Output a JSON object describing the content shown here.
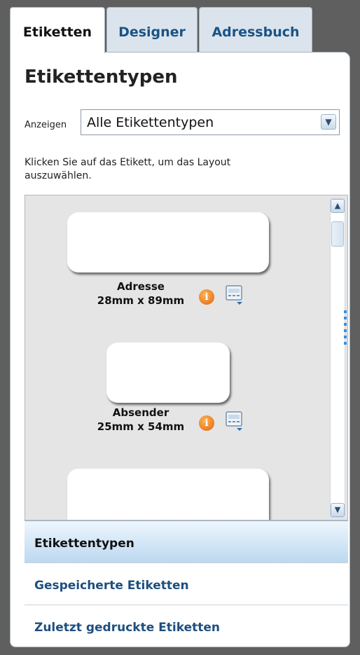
{
  "tabs": [
    {
      "label": "Etiketten",
      "active": true
    },
    {
      "label": "Designer",
      "active": false
    },
    {
      "label": "Adressbuch",
      "active": false
    }
  ],
  "panel": {
    "title": "Etikettentypen",
    "show_label": "Anzeigen",
    "show_select_value": "Alle Etikettentypen",
    "hint": "Klicken Sie auf das Etikett, um das Layout auszuwählen."
  },
  "labels": [
    {
      "name": "Adresse",
      "size": "28mm x 89mm"
    },
    {
      "name": "Absender",
      "size": "25mm x 54mm"
    }
  ],
  "nav": [
    {
      "label": "Etikettentypen",
      "active": true
    },
    {
      "label": "Gespeicherte Etiketten",
      "active": false
    },
    {
      "label": "Zuletzt gedruckte Etiketten",
      "active": false
    }
  ],
  "icons": {
    "info": "info-icon",
    "layout": "layout-options-icon",
    "dropdown": "chevron-down-icon",
    "scroll_up": "chevron-up-icon",
    "scroll_down": "chevron-down-icon"
  },
  "colors": {
    "accent": "#1a5386",
    "active_nav": "#bcd8f0",
    "info_icon": "#e0640a"
  }
}
